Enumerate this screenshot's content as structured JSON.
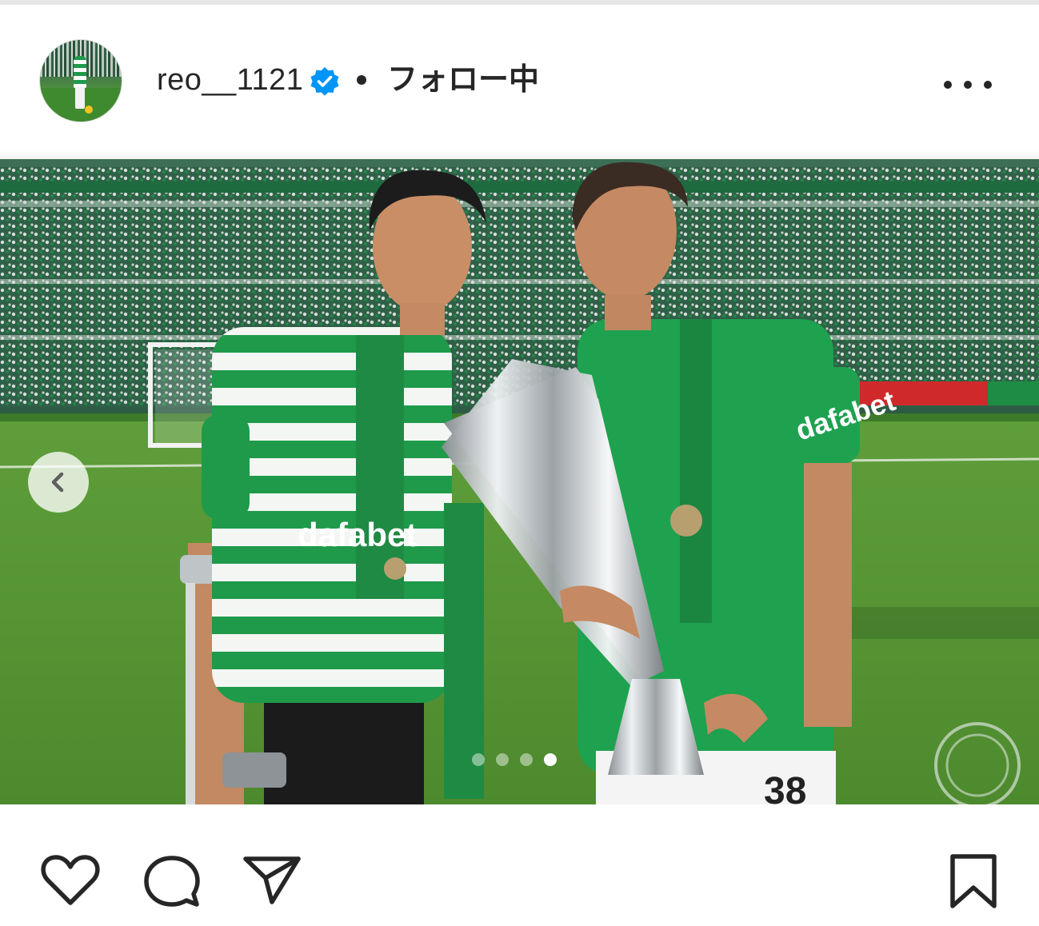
{
  "post": {
    "username": "reo__1121",
    "separator": "•",
    "follow_status": "フォロー中",
    "verified": true
  },
  "icons": {
    "avatar": "profile-avatar",
    "verified": "verified-badge-icon",
    "more": "more-options-icon",
    "prev": "chevron-left-icon",
    "like": "heart-icon",
    "comment": "comment-bubble-icon",
    "share": "paper-plane-icon",
    "save": "bookmark-icon"
  },
  "carousel": {
    "total": 4,
    "active_index": 3
  },
  "photo": {
    "sponsor_text": "dafabet",
    "jersey_number": "38"
  },
  "colors": {
    "verified_blue": "#0095f6",
    "text": "#262626",
    "celtic_green": "#1e9a4a"
  }
}
